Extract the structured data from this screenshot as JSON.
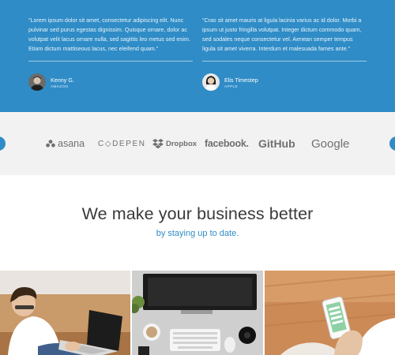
{
  "testimonials": [
    {
      "quote": "“Lorem ipsum dolor sit amet, consectetur adipiscing elit. Nunc pulvinar sed purus egestas dignissim. Quisque ornare, dolor ac volutpat velit lacus ornare nulla, sed sagittis leo metus sed enim. Etiam dictum mattiseous lacus, nec eleifend quam.”",
      "name": "Kenny G.",
      "company": "AMAZON",
      "avatar_icon": "person-avatar-male"
    },
    {
      "quote": "“Cras sit amet mauris at ligula lacinia varius ac id dolor. Morbi a ipsum ut justo fringilla volutpat. Integer dictum commodo quam, sed sodales neque consectetur vel. Aenean semper tempus ligula sit amet viverra. Interdum et malesuada fames ante.”",
      "name": "Elis Timestep",
      "company": "APPLE",
      "avatar_icon": "person-avatar-female"
    }
  ],
  "logos": [
    {
      "id": "asana",
      "text": "asana",
      "icon": "asana-dots-icon"
    },
    {
      "id": "codepen",
      "text": "C◇DEPEN",
      "icon": "codepen-icon"
    },
    {
      "id": "dropbox",
      "text": "Dropbox",
      "icon": "dropbox-box-icon"
    },
    {
      "id": "facebook",
      "text": "facebook.",
      "icon": ""
    },
    {
      "id": "github",
      "text": "GitHub",
      "icon": ""
    },
    {
      "id": "google",
      "text": "Google",
      "icon": ""
    }
  ],
  "carousel": {
    "prev_icon": "arrow-left-icon",
    "next_icon": "arrow-right-icon"
  },
  "hero": {
    "title": "We make your business better",
    "subtitle": "by staying up to date."
  },
  "photos": [
    {
      "icon": "photo-person-laptop"
    },
    {
      "icon": "photo-desk-workspace"
    },
    {
      "icon": "photo-phone-in-hand"
    }
  ],
  "colors": {
    "brand_blue": "#2f8cc6",
    "logo_gray": "#707070",
    "band_gray": "#f2f2f2",
    "headline": "#3a3a3a"
  }
}
